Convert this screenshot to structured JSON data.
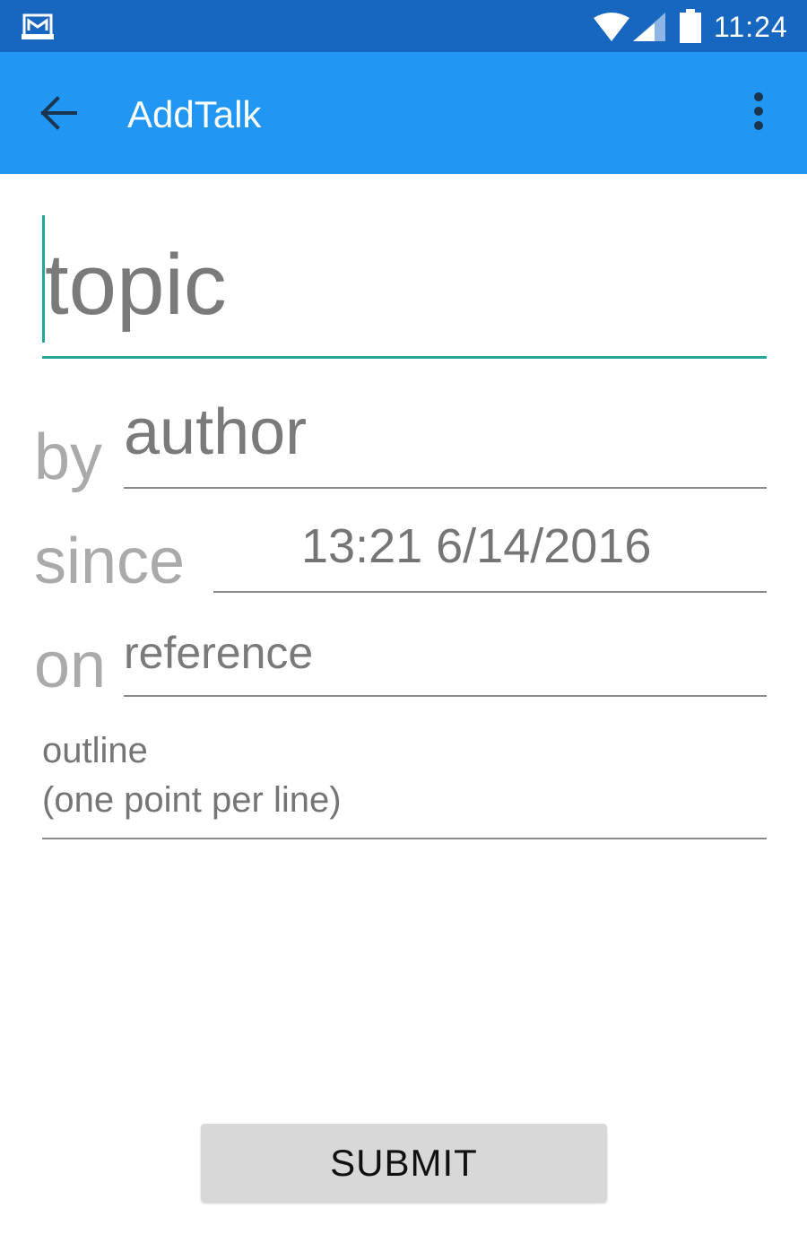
{
  "status_bar": {
    "time": "11:24",
    "icons": [
      "notification-icon",
      "wifi-icon",
      "signal-icon",
      "battery-icon"
    ]
  },
  "app_bar": {
    "title": "AddTalk",
    "back_icon": "arrow-back-icon",
    "overflow_icon": "more-vert-icon"
  },
  "form": {
    "topic_placeholder": "topic",
    "by_label": "by",
    "author_placeholder": "author",
    "since_label": "since",
    "since_value": "13:21 6/14/2016",
    "on_label": "on",
    "reference_placeholder": "reference",
    "outline_placeholder_line1": "outline",
    "outline_placeholder_line2": "(one point per line)"
  },
  "submit_label": "SUBMIT",
  "colors": {
    "status_bar": "#1766c0",
    "app_bar": "#2196f3",
    "accent": "#26a69a",
    "button_bg": "#d7d8d7"
  }
}
